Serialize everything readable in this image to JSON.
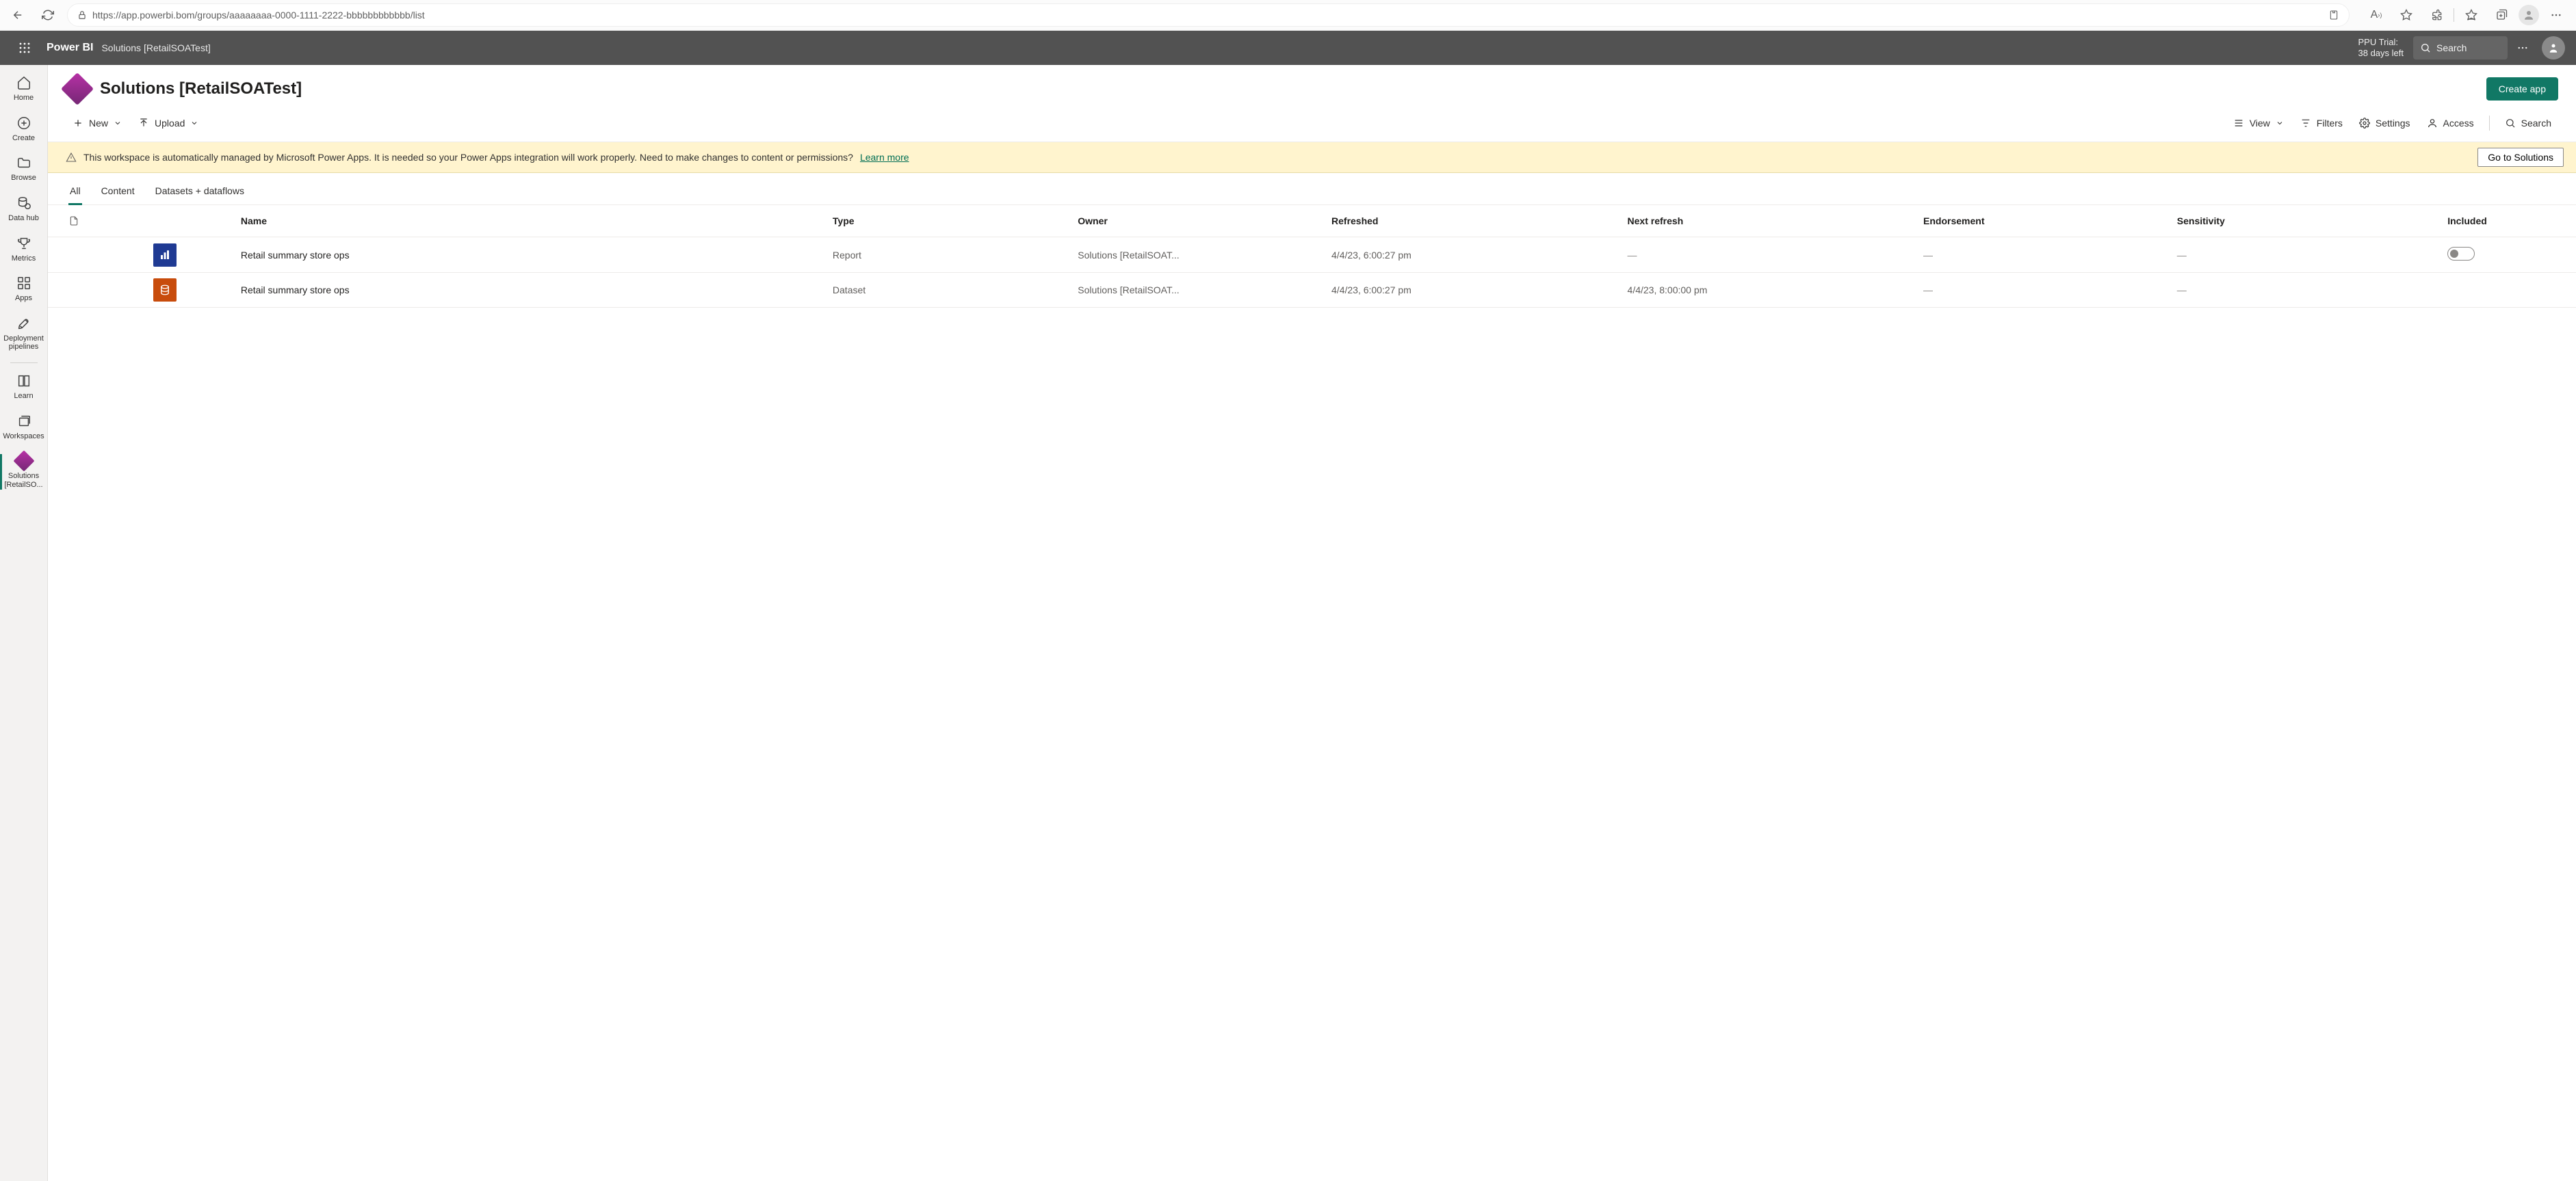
{
  "browser": {
    "url": "https://app.powerbi.bom/groups/aaaaaaaa-0000-1111-2222-bbbbbbbbbbbb/list"
  },
  "app_header": {
    "brand": "Power BI",
    "breadcrumb": "Solutions [RetailSOATest]",
    "trial_line1": "PPU Trial:",
    "trial_line2": "38 days left",
    "search_placeholder": "Search"
  },
  "left_nav": {
    "items": [
      {
        "label": "Home"
      },
      {
        "label": "Create"
      },
      {
        "label": "Browse"
      },
      {
        "label": "Data hub"
      },
      {
        "label": "Metrics"
      },
      {
        "label": "Apps"
      },
      {
        "label": "Deployment pipelines"
      },
      {
        "label": "Learn"
      },
      {
        "label": "Workspaces"
      },
      {
        "label": "Solutions [RetailSO..."
      }
    ]
  },
  "workspace": {
    "title": "Solutions [RetailSOATest]",
    "create_app_label": "Create app"
  },
  "cmd_bar": {
    "new_label": "New",
    "upload_label": "Upload",
    "view_label": "View",
    "filters_label": "Filters",
    "settings_label": "Settings",
    "access_label": "Access",
    "search_label": "Search"
  },
  "banner": {
    "message": "This workspace is automatically managed by Microsoft Power Apps. It is needed so your Power Apps integration will work properly. Need to make changes to content or permissions?",
    "learn_more": "Learn more",
    "go_to_solutions": "Go to Solutions"
  },
  "tabs": {
    "all": "All",
    "content": "Content",
    "datasets": "Datasets + dataflows"
  },
  "table": {
    "headers": {
      "name": "Name",
      "type": "Type",
      "owner": "Owner",
      "refreshed": "Refreshed",
      "next_refresh": "Next refresh",
      "endorsement": "Endorsement",
      "sensitivity": "Sensitivity",
      "included": "Included"
    },
    "rows": [
      {
        "icon_type": "report",
        "name": "Retail summary store ops",
        "type": "Report",
        "owner": "Solutions [RetailSOAT...",
        "refreshed": "4/4/23, 6:00:27 pm",
        "next_refresh": "—",
        "endorsement": "—",
        "sensitivity": "—",
        "included_toggle": true
      },
      {
        "icon_type": "dataset",
        "name": "Retail summary store ops",
        "type": "Dataset",
        "owner": "Solutions [RetailSOAT...",
        "refreshed": "4/4/23, 6:00:27 pm",
        "next_refresh": "4/4/23, 8:00:00 pm",
        "endorsement": "—",
        "sensitivity": "—",
        "included_toggle": false
      }
    ]
  }
}
